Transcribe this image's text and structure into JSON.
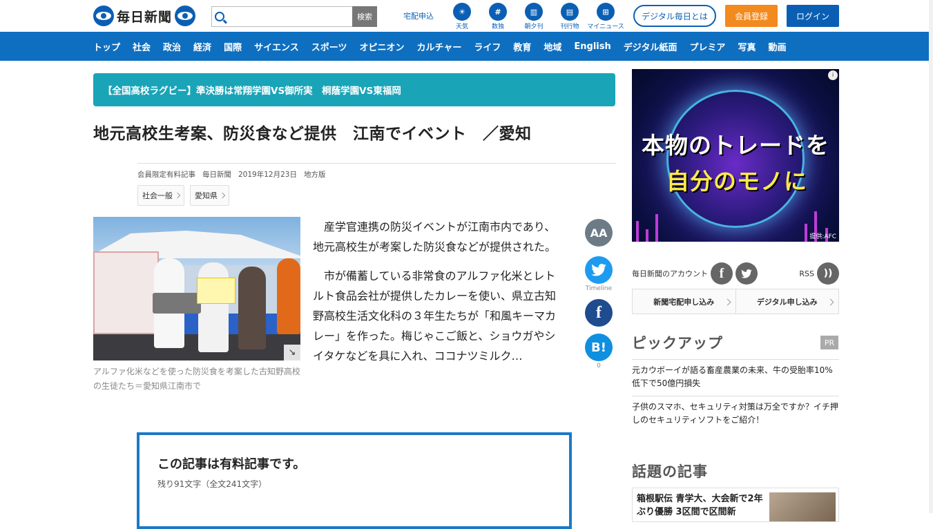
{
  "header": {
    "logo_text": "毎日新聞",
    "search_placeholder": "",
    "search_button": "検索",
    "delivery_link": "宅配申込",
    "icons": [
      {
        "label": "天気",
        "icon": "weather-icon",
        "glyph": "☀"
      },
      {
        "label": "数独",
        "icon": "sudoku-icon",
        "glyph": "#"
      },
      {
        "label": "朝夕刊",
        "icon": "newspaper-icon",
        "glyph": "▥"
      },
      {
        "label": "刊行物",
        "icon": "book-icon",
        "glyph": "▤"
      },
      {
        "label": "マイニュース",
        "icon": "mynews-icon",
        "glyph": "⊞"
      }
    ],
    "digital_button": "デジタル毎日とは",
    "register_button": "会員登録",
    "login_button": "ログイン"
  },
  "nav": {
    "items": [
      "トップ",
      "社会",
      "政治",
      "経済",
      "国際",
      "サイエンス",
      "スポーツ",
      "オピニオン",
      "カルチャー",
      "ライフ",
      "教育",
      "地域",
      "English",
      "デジタル紙面",
      "プレミア",
      "写真",
      "動画"
    ]
  },
  "banner": {
    "text": "【全国高校ラグビー】準決勝は常翔学園VS御所実　桐蔭学園VS東福岡"
  },
  "article": {
    "headline": "地元高校生考案、防災食など提供　江南でイベント　／愛知",
    "meta": {
      "type": "会員限定有料記事",
      "source": "毎日新聞",
      "date": "2019年12月23日",
      "edition": "地方版"
    },
    "tags": [
      "社会一般",
      "愛知県"
    ],
    "photo_caption": "アルファ化米などを使った防災食を考案した古知野高校の生徒たち＝愛知県江南市で",
    "paragraphs": [
      "産学官連携の防災イベントが江南市内であり、地元高校生が考案した防災食などが提供された。",
      "市が備蓄している非常食のアルファ化米とレトルト食品会社が提供したカレーを使い、県立古知野高校生活文化科の３年生たちが「和風キーマカレー」を作った。梅じゃこご飯と、ショウガやシイタケなどを具に入れ、ココナツミルク…"
    ],
    "share": {
      "font_size_label": "AA",
      "twitter_label": "Timeline",
      "hatena_label": "B!",
      "hatena_count": "0"
    },
    "paywall": {
      "title": "この記事は有料記事です。",
      "remaining": "残り91文字（全文241文字）"
    }
  },
  "sidebar": {
    "ad": {
      "line1": "本物のトレードを",
      "line2": "自分のモノに",
      "credit": "提供:AFC",
      "info_icon": "i"
    },
    "account_label": "毎日新聞のアカウント",
    "rss_label": "RSS",
    "subscribe": [
      "新聞宅配申し込み",
      "デジタル申し込み"
    ],
    "pickup_title": "ピックアップ",
    "pr_badge": "PR",
    "pickup_items": [
      "元カウボーイが語る畜産農業の未来、牛の受胎率10%低下で50億円損失",
      "子供のスマホ、セキュリティ対策は万全ですか？イチ押しのセキュリティソフトをご紹介！"
    ],
    "topics_title": "話題の記事",
    "topic_item": "箱根駅伝 青学大、大会新で2年ぶり優勝 3区間で区間新"
  },
  "colors": {
    "brand_blue": "#0a5fb4",
    "nav_blue": "#0e6fc1",
    "banner_teal": "#1aa4b8",
    "register_orange": "#f28a1e"
  }
}
